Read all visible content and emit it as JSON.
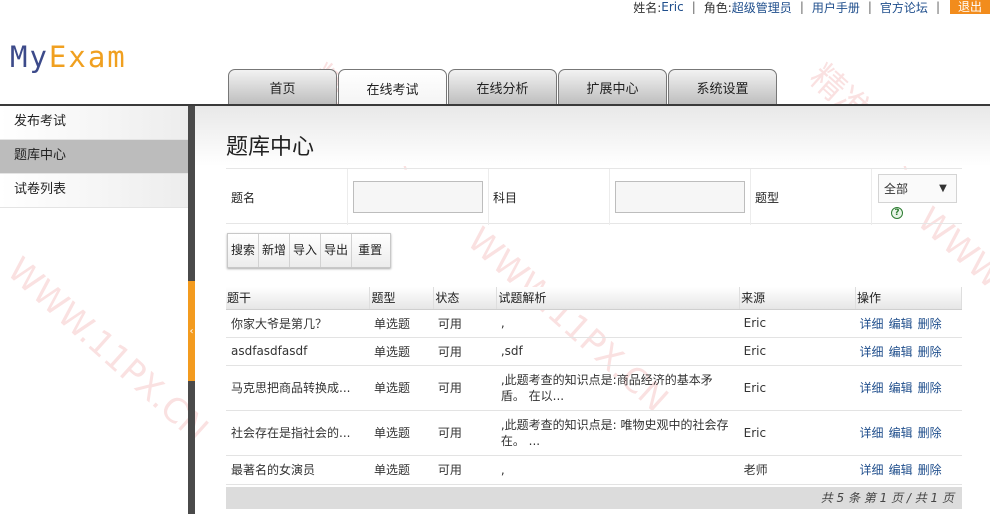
{
  "topbar": {
    "name_label": "姓名:",
    "name_value": "Eric",
    "role_label": "角色:",
    "role_value": "超级管理员",
    "manual": "用户手册",
    "forum": "官方论坛",
    "logout": "退出",
    "separator": "|"
  },
  "logo": {
    "part1": "My",
    "part2": "Exam"
  },
  "nav": {
    "tabs": [
      "首页",
      "在线考试",
      "在线分析",
      "扩展中心",
      "系统设置"
    ],
    "active": "在线考试"
  },
  "sidebar": {
    "items": [
      "发布考试",
      "题库中心",
      "试卷列表"
    ],
    "active": "题库中心",
    "toggle_glyph": "‹"
  },
  "page": {
    "title": "题库中心"
  },
  "filters": {
    "name_label": "题名",
    "name_value": "",
    "subject_label": "科目",
    "subject_value": "",
    "type_label": "题型",
    "type_selected": "全部",
    "help_glyph": "?"
  },
  "buttons": {
    "search": "搜索",
    "add": "新增",
    "import": "导入",
    "export": "导出",
    "reset": "重置"
  },
  "table": {
    "headers": [
      "题干",
      "题型",
      "状态",
      "试题解析",
      "来源",
      "操作"
    ],
    "actions": [
      "详细",
      "编辑",
      "删除"
    ],
    "rows": [
      {
        "stem": "你家大爷是第几？",
        "type": "单选题",
        "status": "可用",
        "analysis": ",",
        "source": "Eric"
      },
      {
        "stem": "asdfasdfasdf",
        "type": "单选题",
        "status": "可用",
        "analysis": ",sdf",
        "source": "Eric"
      },
      {
        "stem": "马克思把商品转换成...",
        "type": "单选题",
        "status": "可用",
        "analysis": ",此题考查的知识点是:商品经济的基本矛盾。 在以...",
        "source": "Eric"
      },
      {
        "stem": "社会存在是指社会的...",
        "type": "单选题",
        "status": "可用",
        "analysis": ",此题考查的知识点是: 唯物史观中的社会存在。 ...",
        "source": "Eric"
      },
      {
        "stem": "最著名的女演员",
        "type": "单选题",
        "status": "可用",
        "analysis": ",",
        "source": "老师"
      }
    ]
  },
  "pager": {
    "text": "共 5 条 第 1 页 / 共 1 页"
  },
  "watermark": {
    "text1": "精准像素",
    "text2": "WWW.11PX.CN"
  },
  "colors": {
    "accent_orange": "#f28c1c",
    "link_blue": "#1f4e8c",
    "nav_dark": "#3a3a3a"
  }
}
